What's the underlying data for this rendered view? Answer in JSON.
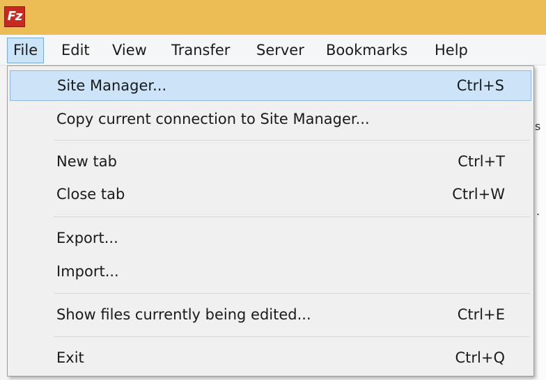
{
  "app": {
    "icon_text": "Fz"
  },
  "menubar": {
    "items": [
      {
        "label": "File"
      },
      {
        "label": "Edit"
      },
      {
        "label": "View"
      },
      {
        "label": "Transfer"
      },
      {
        "label": "Server"
      },
      {
        "label": "Bookmarks"
      },
      {
        "label": "Help"
      }
    ],
    "active": "File"
  },
  "file_menu": {
    "items": [
      {
        "label": "Site Manager...",
        "shortcut": "Ctrl+S",
        "highlighted": true
      },
      {
        "label": "Copy current connection to Site Manager...",
        "shortcut": ""
      },
      {
        "label": "New tab",
        "shortcut": "Ctrl+T"
      },
      {
        "label": "Close tab",
        "shortcut": "Ctrl+W"
      },
      {
        "label": "Export...",
        "shortcut": ""
      },
      {
        "label": "Import...",
        "shortcut": ""
      },
      {
        "label": "Show files currently being edited...",
        "shortcut": "Ctrl+E"
      },
      {
        "label": "Exit",
        "shortcut": "Ctrl+Q"
      }
    ]
  },
  "background": {
    "partial_text_1": "s",
    "partial_text_2": "."
  },
  "colors": {
    "titlebar": "#ecbc55",
    "icon_red": "#c62a20",
    "highlight": "#cde4f8",
    "highlight_border": "#8fb8e0",
    "menu_bg": "#f0f0f0"
  }
}
